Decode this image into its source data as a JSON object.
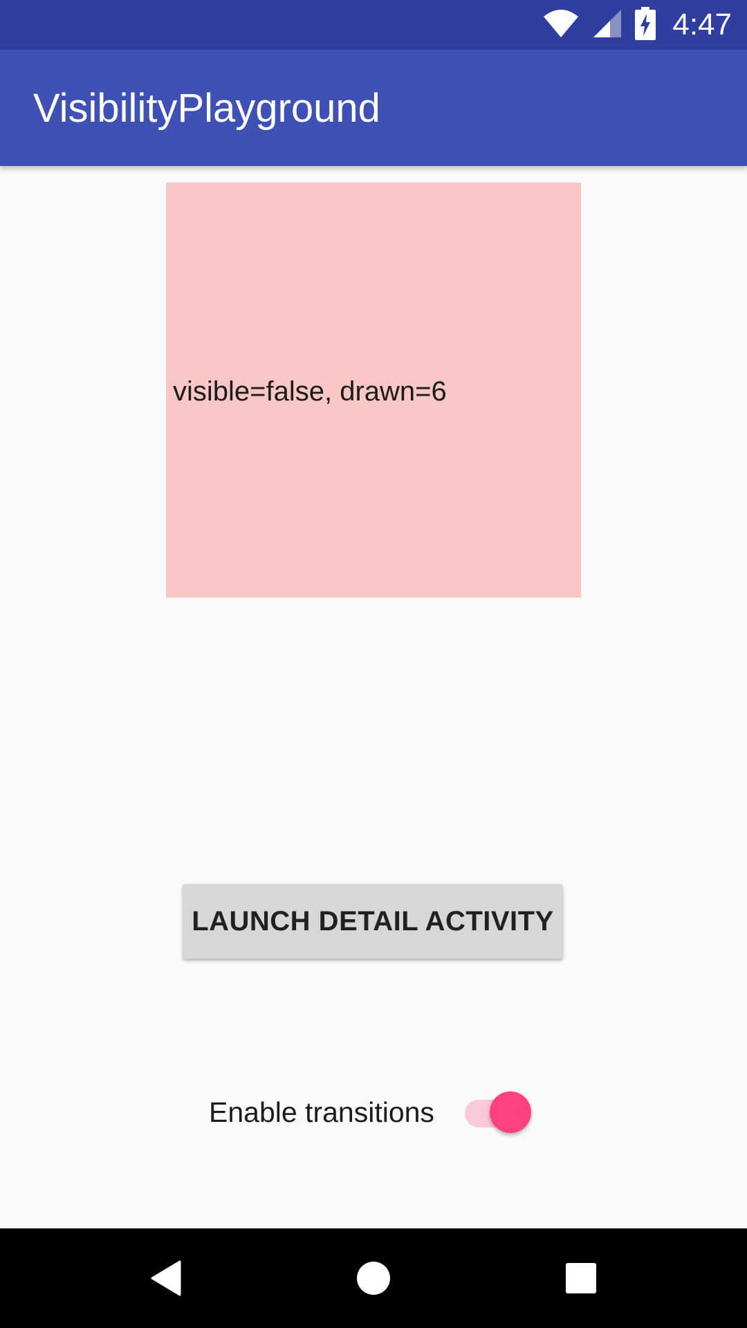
{
  "status_bar": {
    "time": "4:47",
    "icons": [
      "wifi-icon",
      "cell-signal-icon",
      "battery-charging-icon"
    ]
  },
  "app_bar": {
    "title": "VisibilityPlayground"
  },
  "pink_box": {
    "text": "visible=false, drawn=6",
    "color": "#f8c7c6"
  },
  "launch_button": {
    "label": "LAUNCH DETAIL ACTIVITY"
  },
  "transitions_toggle": {
    "label": "Enable transitions",
    "checked": true,
    "accent": "#ff4081"
  },
  "nav_bar": {
    "buttons": [
      "back-icon",
      "home-icon",
      "recents-icon"
    ]
  },
  "colors": {
    "status_bar": "#303f9f",
    "app_bar": "#3f51b5",
    "background": "#fafafa"
  }
}
